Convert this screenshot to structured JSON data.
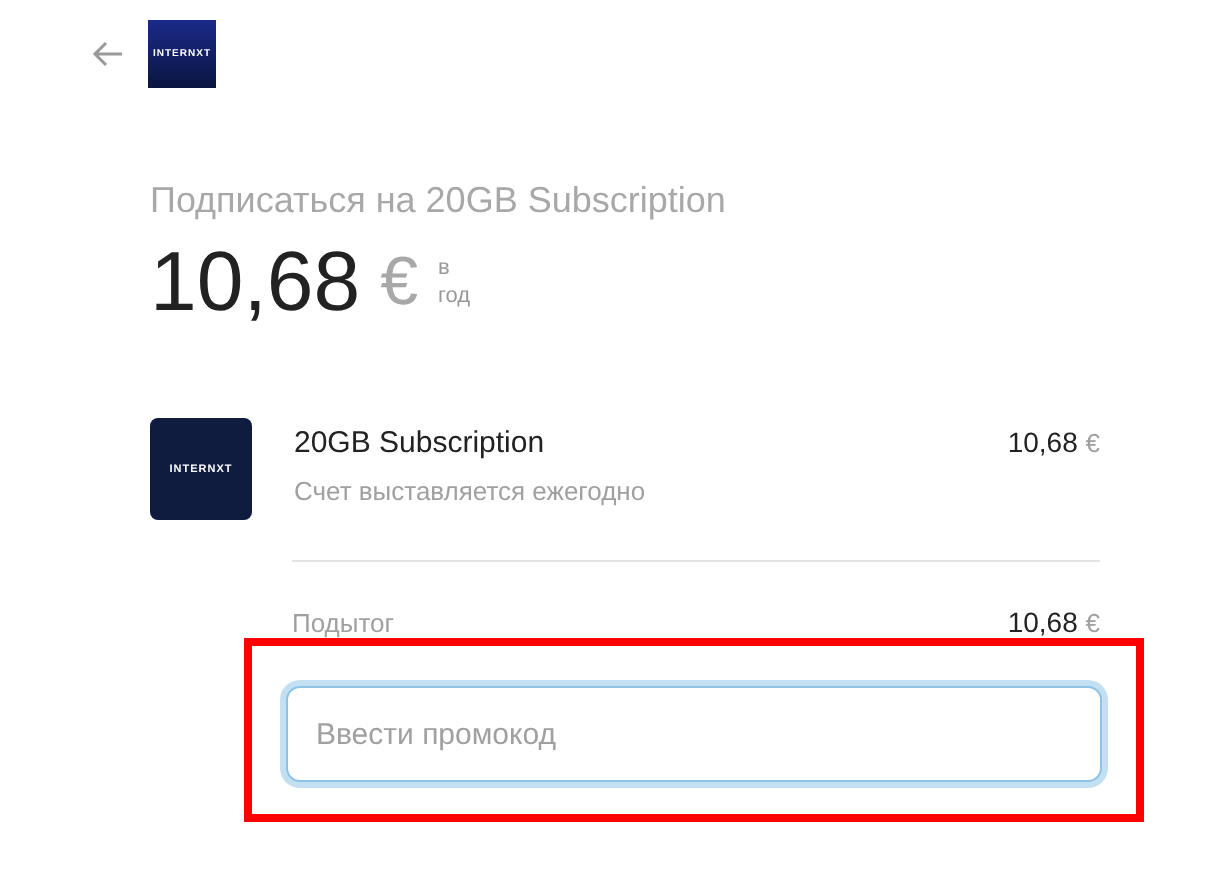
{
  "header": {
    "logo": "INTERNXT"
  },
  "title": "Подписаться на 20GB Subscription",
  "price": {
    "amount": "10,68",
    "currency": "€",
    "period": [
      "в",
      "год"
    ]
  },
  "item": {
    "logo": "INTERNXT",
    "name": "20GB Subscription",
    "billing": "Счет выставляется ежегодно",
    "amount": "10,68",
    "currency": "€"
  },
  "subtotal": {
    "label": "Подытог",
    "amount": "10,68",
    "currency": "€"
  },
  "promo": {
    "placeholder": "Ввести промокод",
    "highlighted": true
  }
}
